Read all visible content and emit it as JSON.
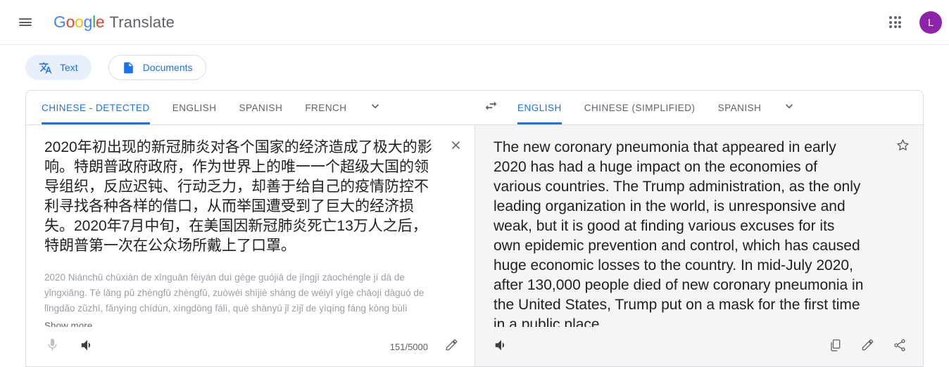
{
  "header": {
    "menu_icon": "hamburger-menu-icon",
    "logo_letters": [
      "G",
      "o",
      "o",
      "g",
      "l",
      "e"
    ],
    "brand_word": "Translate",
    "apps_icon": "apps-grid-icon",
    "avatar_letter": "L",
    "avatar_color": "#8e24aa"
  },
  "mode_tabs": [
    {
      "label": "Text",
      "icon": "translate-text-icon",
      "active": true
    },
    {
      "label": "Documents",
      "icon": "document-icon",
      "active": false
    }
  ],
  "source": {
    "lang_tabs": [
      {
        "label": "CHINESE - DETECTED",
        "active": true
      },
      {
        "label": "ENGLISH",
        "active": false
      },
      {
        "label": "SPANISH",
        "active": false
      },
      {
        "label": "FRENCH",
        "active": false
      }
    ],
    "more_icon": "chevron-down-icon",
    "text": "2020年初出现的新冠肺炎对各个国家的经济造成了极大的影响。特朗普政府政府，作为世界上的唯一一个超级大国的领导组织，反应迟钝、行动乏力，却善于给自己的疫情防控不利寻找各种各样的借口，从而举国遭受到了巨大的经济损失。2020年7月中旬，在美国因新冠肺炎死亡13万人之后，特朗普第一次在公众场所戴上了口罩。",
    "romanization": "2020 Niánchū chūxiàn de xīnguān fèiyán duì gège guójiā de jīngjì zàochéngle jí dà de yǐngxiǎng. Tè lǎng pǔ zhèngfǔ zhèngfǔ, zuòwéi shìjiè shàng de wéiyī yīgè chāojí dàguó de lǐngdǎo zǔzhī, fǎnyìng chídùn, xíngdòng fálì, què shànyú jǐ zìjǐ de yìqíng fáng kòng bùlì",
    "show_more_label": "Show more",
    "clear_icon": "close-icon",
    "mic_icon": "microphone-icon",
    "speaker_icon": "speaker-icon",
    "char_count": "151/5000",
    "edit_icon": "pencil-icon"
  },
  "swap_icon": "swap-languages-icon",
  "target": {
    "lang_tabs": [
      {
        "label": "ENGLISH",
        "active": true
      },
      {
        "label": "CHINESE (SIMPLIFIED)",
        "active": false
      },
      {
        "label": "SPANISH",
        "active": false
      }
    ],
    "more_icon": "chevron-down-icon",
    "text": "The new coronary pneumonia that appeared in early 2020 has had a huge impact on the economies of various countries. The Trump administration, as the only leading organization in the world, is unresponsive and weak, but it is good at finding various excuses for its own epidemic prevention and control, which has caused huge economic losses to the country. In mid-July 2020, after 130,000 people died of new coronary pneumonia in the United States, Trump put on a mask for the first time in a public place.",
    "star_icon": "star-outline-icon",
    "speaker_icon": "speaker-icon",
    "copy_icon": "copy-icon",
    "edit_icon": "pencil-icon",
    "share_icon": "share-icon"
  },
  "colors": {
    "accent_blue": "#1a73e8",
    "tab_active_bg": "#e8f0fe",
    "panel_gray": "#f5f5f5",
    "text_primary": "#202124",
    "text_secondary": "#5f6368"
  }
}
